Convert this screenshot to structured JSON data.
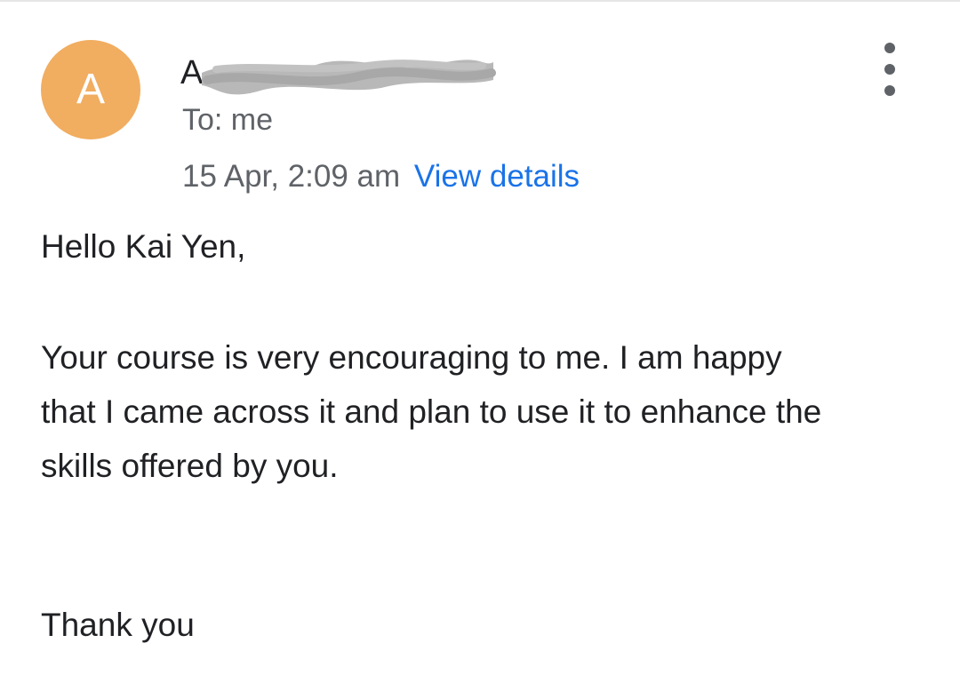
{
  "header": {
    "avatar_letter": "A",
    "sender_visible_initial": "A",
    "sender_redacted": true,
    "recipient_line": "To: me",
    "date": "15 Apr, 2:09 am",
    "view_details_label": "View details",
    "menu_icon": "more-vert-icon"
  },
  "message": {
    "greeting": "Hello Kai Yen,",
    "paragraph": "Your course is very encouraging to me. I am happy\nthat I came across it and  plan to use it to enhance the\nskills offered by you.",
    "closing": "Thank you"
  },
  "colors": {
    "avatar_background": "#f1ad60",
    "link": "#1a73e8",
    "secondary_text": "#5f6368",
    "body_text": "#202124",
    "redaction": "#b8b8b8"
  }
}
